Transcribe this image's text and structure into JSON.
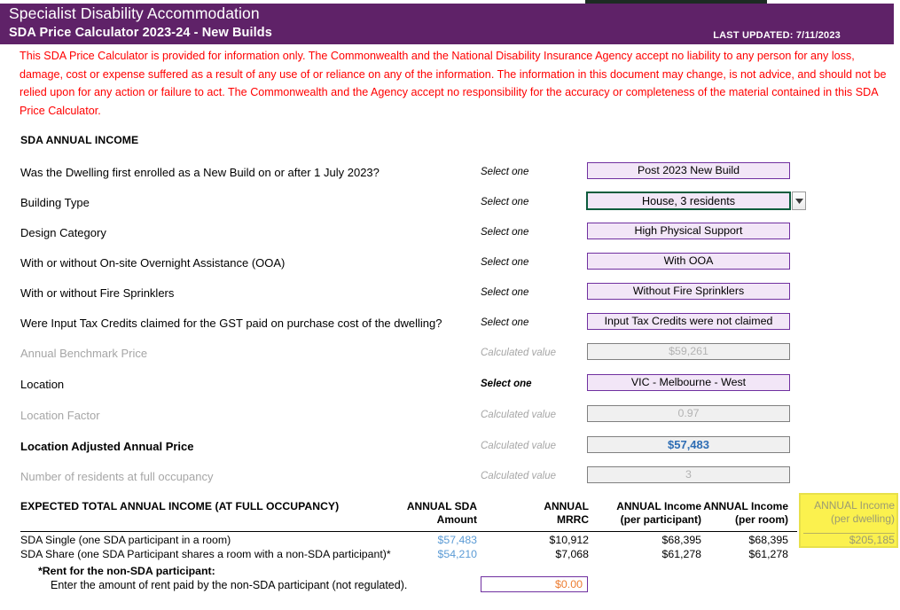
{
  "header": {
    "title": "Specialist Disability Accommodation",
    "subtitle": "SDA Price Calculator 2023-24 - New Builds",
    "last_updated": "LAST UPDATED:  7/11/2023",
    "brand_purple": "#5f2268"
  },
  "disclaimer": "This SDA Price Calculator is provided for information only.  The Commonwealth and the National Disability Insurance Agency accept no liability to any person for any loss, damage, cost or expense suffered as a result of any use of or reliance on any of the information.  The information in this document may change, is not advice, and should not be relied upon for any action or failure to act. The Commonwealth and the Agency accept no responsibility for the accuracy or completeness of the material contained in this SDA Price Calculator.",
  "section": {
    "title": "SDA ANNUAL INCOME"
  },
  "form": {
    "rows": [
      {
        "label": "Was the Dwelling first enrolled as a New Build on or after 1 July 2023?",
        "hint": "Select one",
        "value": "Post 2023 New Build",
        "kind": "select"
      },
      {
        "label": "Building Type",
        "hint": "Select one",
        "value": "House, 3 residents",
        "kind": "select-active"
      },
      {
        "label": "Design Category",
        "hint": "Select one",
        "value": "High Physical Support",
        "kind": "select"
      },
      {
        "label": "With or without On-site Overnight Assistance (OOA)",
        "hint": "Select one",
        "value": "With OOA",
        "kind": "select"
      },
      {
        "label": "With or without Fire Sprinklers",
        "hint": "Select one",
        "value": "Without Fire Sprinklers",
        "kind": "select"
      },
      {
        "label": "Were Input Tax Credits claimed for the GST paid on purchase cost of the dwelling?",
        "hint": "Select one",
        "value": "Input Tax Credits were not claimed",
        "kind": "select"
      },
      {
        "label": "Annual Benchmark Price",
        "hint": "Calculated value",
        "value": "$59,261",
        "kind": "calc"
      },
      {
        "label": "Location",
        "hint": "Select one",
        "value": "VIC - Melbourne - West",
        "kind": "select"
      },
      {
        "label": "Location Factor",
        "hint": "Calculated value",
        "value": "0.97",
        "kind": "calc"
      },
      {
        "label": "Location Adjusted Annual Price",
        "hint": "Calculated value",
        "value": "$57,483",
        "kind": "calc-blue"
      },
      {
        "label": "Number of residents at full occupancy",
        "hint": "Calculated value",
        "value": "3",
        "kind": "calc"
      }
    ]
  },
  "results": {
    "title": "EXPECTED TOTAL ANNUAL INCOME (AT FULL OCCUPANCY)",
    "columns": [
      {
        "line1": "ANNUAL SDA",
        "line2": "Amount"
      },
      {
        "line1": "ANNUAL",
        "line2": "MRRC"
      },
      {
        "line1": "ANNUAL Income",
        "line2": "(per participant)"
      },
      {
        "line1": "ANNUAL Income",
        "line2": "(per room)"
      },
      {
        "line1": "ANNUAL Income",
        "line2": "(per dwelling)"
      }
    ],
    "rows": [
      {
        "label": "SDA Single (one SDA participant in a room)",
        "sda_amount": "$57,483",
        "mrrc": "$10,912",
        "per_participant": "$68,395",
        "per_room": "$68,395",
        "per_dwelling": "$205,185"
      },
      {
        "label": "SDA Share (one SDA Participant shares a room with a non-SDA participant)*",
        "sda_amount": "$54,210",
        "mrrc": "$7,068",
        "per_participant": "$61,278",
        "per_room": "$61,278",
        "per_dwelling": ""
      }
    ],
    "footnote_bold": "*Rent for the non-SDA participant:",
    "footnote_text": "Enter the amount of rent paid by the non-SDA participant (not regulated).",
    "rent_value": "$0.00",
    "highlight_yellow": "#fbf14e"
  }
}
